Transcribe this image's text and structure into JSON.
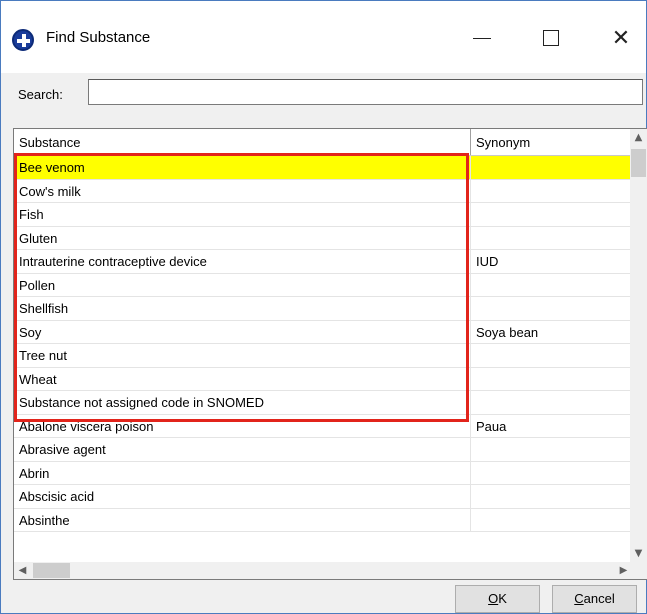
{
  "window": {
    "title": "Find Substance",
    "icon": "app-cross-icon",
    "controls": {
      "minimize": "—",
      "maximize": "☐",
      "close": "✕"
    }
  },
  "search": {
    "label": "Search:",
    "value": "",
    "placeholder": ""
  },
  "grid": {
    "columns": [
      "Substance",
      "Synonym"
    ],
    "rows": [
      {
        "substance": "Bee venom",
        "synonym": "",
        "selected": true
      },
      {
        "substance": "Cow's milk",
        "synonym": ""
      },
      {
        "substance": "Fish",
        "synonym": ""
      },
      {
        "substance": "Gluten",
        "synonym": ""
      },
      {
        "substance": "Intrauterine contraceptive device",
        "synonym": "IUD"
      },
      {
        "substance": "Pollen",
        "synonym": ""
      },
      {
        "substance": "Shellfish",
        "synonym": ""
      },
      {
        "substance": "Soy",
        "synonym": "Soya bean"
      },
      {
        "substance": "Tree nut",
        "synonym": ""
      },
      {
        "substance": "Wheat",
        "synonym": ""
      },
      {
        "substance": "Substance not assigned code in SNOMED",
        "synonym": ""
      },
      {
        "substance": "Abalone viscera poison",
        "synonym": "Paua"
      },
      {
        "substance": "Abrasive agent",
        "synonym": ""
      },
      {
        "substance": "Abrin",
        "synonym": ""
      },
      {
        "substance": "Abscisic acid",
        "synonym": ""
      },
      {
        "substance": "Absinthe",
        "synonym": ""
      }
    ],
    "selected_color": "#ffff00",
    "highlight_color": "#e2241b"
  },
  "buttons": {
    "ok": {
      "mnemonic": "O",
      "rest": "K"
    },
    "cancel": {
      "mnemonic": "C",
      "rest": "ancel"
    }
  }
}
